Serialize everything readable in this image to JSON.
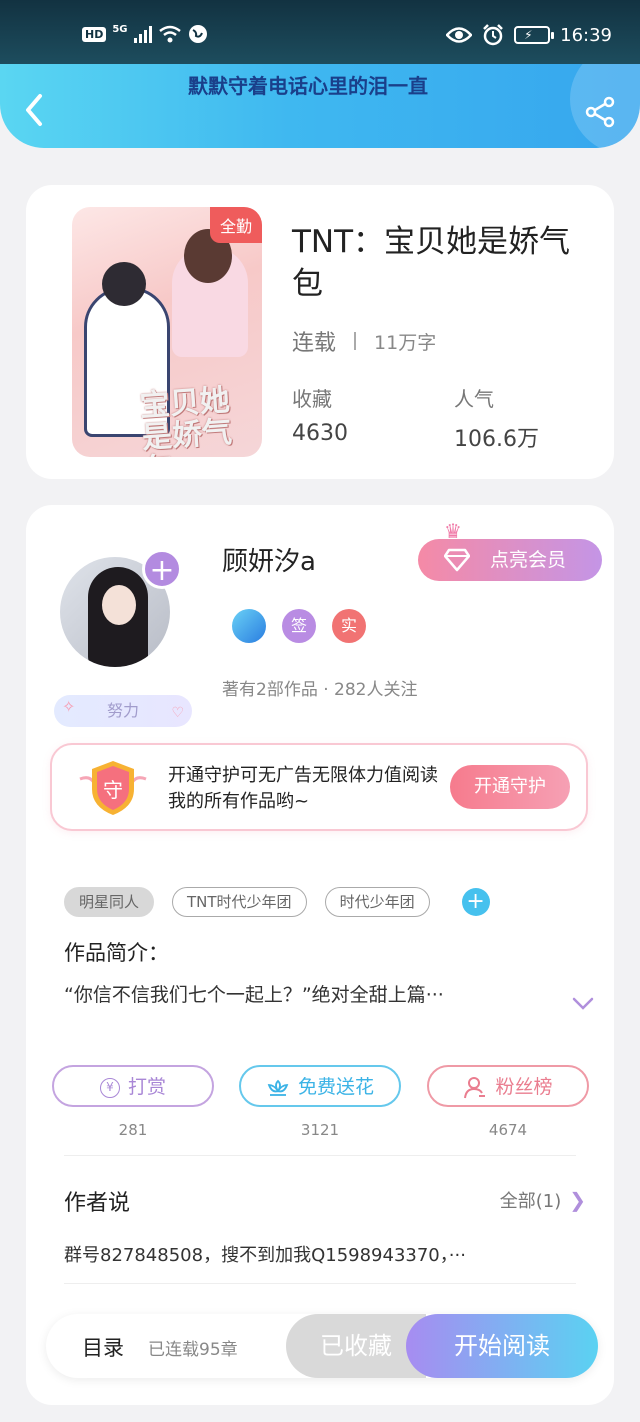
{
  "status_bar": {
    "hd": "HD",
    "network": "5G",
    "time": "16:39"
  },
  "header": {
    "title": "默默守着电话心里的泪一直"
  },
  "book": {
    "cover_tag": "全勤",
    "cover_title": "宝贝她是娇气包",
    "title": "TNT：宝贝她是娇气包",
    "status": "连载",
    "word_count": "11万字",
    "favorites_label": "收藏",
    "favorites_value": "4630",
    "popularity_label": "人气",
    "popularity_value": "106.6万"
  },
  "author": {
    "name": "顾妍汐a",
    "effort_label": "努力",
    "vip_button": "点亮会员",
    "badges": [
      "",
      "签",
      "实"
    ],
    "works_line": "著有2部作品 · 282人关注",
    "guard_icon_text": "守",
    "guard_text": "开通守护可无广告无限体力值阅读我的所有作品哟~",
    "guard_button": "开通守护"
  },
  "tags": [
    "明星同人",
    "TNT时代少年团",
    "时代少年团"
  ],
  "intro": {
    "label": "作品简介：",
    "text": "“你信不信我们七个一起上？”绝对全甜上篇···"
  },
  "actions": {
    "tip_label": "打赏",
    "tip_count": "281",
    "flower_label": "免费送花",
    "flower_count": "3121",
    "fans_label": "粉丝榜",
    "fans_count": "4674"
  },
  "author_says": {
    "label": "作者说",
    "all_label": "全部(1)",
    "text": "群号827848508，搜不到加我Q1598943370，···"
  },
  "bottom_bar": {
    "toc": "目录",
    "chapters": "已连载95章",
    "collected": "已收藏",
    "start_reading": "开始阅读"
  },
  "colors": {
    "header_gradient_start": "#5ad6f2",
    "header_gradient_end": "#36a6ee",
    "accent_purple": "#b38be0",
    "accent_pink": "#f67b8d",
    "accent_blue": "#46c1ee"
  }
}
